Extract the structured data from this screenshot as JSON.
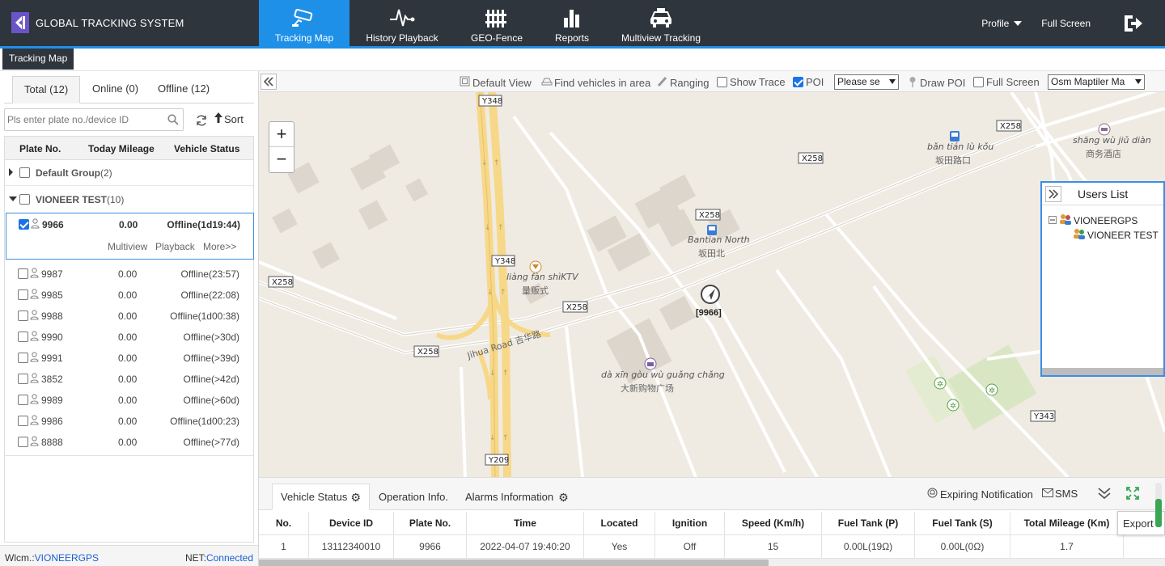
{
  "app": {
    "title": "GLOBAL TRACKING SYSTEM",
    "brand_color": "#6a55c8",
    "accent": "#1e90e8"
  },
  "nav": [
    {
      "label": "Tracking Map",
      "icon": "camera-icon",
      "active": true
    },
    {
      "label": "History Playback",
      "icon": "pulse-icon",
      "active": false
    },
    {
      "label": "GEO-Fence",
      "icon": "fence-icon",
      "active": false
    },
    {
      "label": "Reports",
      "icon": "bar-chart-icon",
      "active": false
    },
    {
      "label": "Multiview Tracking",
      "icon": "taxi-icon",
      "active": false
    }
  ],
  "top_right": {
    "profile": "Profile",
    "fullscreen": "Full Screen"
  },
  "page_tab": "Tracking Map",
  "left": {
    "tabs": [
      "Total (12)",
      "Online (0)",
      "Offline (12)"
    ],
    "search_placeholder": "Pls enter plate no./device ID",
    "sort_label": "Sort",
    "columns": [
      "Plate No.",
      "Today Mileage",
      "Vehicle Status"
    ],
    "groups": [
      {
        "name": "Default Group",
        "count": "(2)"
      },
      {
        "name": "VIONEER TEST",
        "count": "(10)"
      }
    ],
    "selected": {
      "plate": "9966",
      "mileage": "0.00",
      "status": "Offline(1d19:44)",
      "actions": [
        "Multiview",
        "Playback",
        "More>>"
      ]
    },
    "vehicles": [
      {
        "plate": "9987",
        "mileage": "0.00",
        "status": "Offline(23:57)"
      },
      {
        "plate": "9985",
        "mileage": "0.00",
        "status": "Offline(22:08)"
      },
      {
        "plate": "9988",
        "mileage": "0.00",
        "status": "Offline(1d00:38)"
      },
      {
        "plate": "9990",
        "mileage": "0.00",
        "status": "Offline(>30d)"
      },
      {
        "plate": "9991",
        "mileage": "0.00",
        "status": "Offline(>39d)"
      },
      {
        "plate": "3852",
        "mileage": "0.00",
        "status": "Offline(>42d)"
      },
      {
        "plate": "9989",
        "mileage": "0.00",
        "status": "Offline(>60d)"
      },
      {
        "plate": "9986",
        "mileage": "0.00",
        "status": "Offline(1d00:23)"
      },
      {
        "plate": "8888",
        "mileage": "0.00",
        "status": "Offline(>77d)"
      }
    ],
    "footer": {
      "wlcm_label": "Wlcm.:",
      "user": "VIONEERGPS",
      "net_label": "NET:",
      "net_status": "Connected"
    }
  },
  "toolbar": {
    "default_view": "Default View",
    "find_vehicles": "Find vehicles in area",
    "ranging": "Ranging",
    "show_trace": "Show Trace",
    "poi": "POI",
    "poi_select": "Please se",
    "draw_poi": "Draw POI",
    "full_screen": "Full Screen",
    "map_select": "Osm Maptiler Ma"
  },
  "map": {
    "zoom_in": "+",
    "zoom_out": "−",
    "vehicle_marker": "[9966]",
    "road_labels": [
      "Y348",
      "Y348",
      "X258",
      "X258",
      "X258",
      "X258",
      "X258",
      "X258",
      "Y209",
      "Y343"
    ],
    "road_name": "Jihua Road 吉华路",
    "places": [
      {
        "pinyin": "bǎn tián lù kǒu",
        "cn": "坂田路口"
      },
      {
        "pinyin": "shāng wù jiǔ diàn",
        "cn": "商务酒店"
      },
      {
        "pinyin": "Bantian North",
        "cn": "坂田北"
      },
      {
        "pinyin": "liàng fàn shìKTV",
        "cn": "量贩式"
      },
      {
        "pinyin": "dà xīn gòu wù guǎng chǎng",
        "cn": "大新购物广场"
      }
    ]
  },
  "users_list": {
    "title": "Users List",
    "nodes": [
      "VIONEERGPS",
      "VIONEER TEST"
    ]
  },
  "bottom": {
    "tabs": [
      "Vehicle Status",
      "Operation Info.",
      "Alarms Information"
    ],
    "expiring": "Expiring Notification",
    "sms": "SMS",
    "export": "Export",
    "columns": [
      "No.",
      "Device ID",
      "Plate No.",
      "Time",
      "Located",
      "Ignition",
      "Speed (Km/h)",
      "Fuel Tank (P)",
      "Fuel Tank (S)",
      "Total Mileage (Km)"
    ],
    "rows": [
      [
        "1",
        "13112340010",
        "9966",
        "2022-04-07 19:40:20",
        "Yes",
        "Off",
        "15",
        "0.00L(19Ω)",
        "0.00L(0Ω)",
        "1.7"
      ]
    ]
  }
}
